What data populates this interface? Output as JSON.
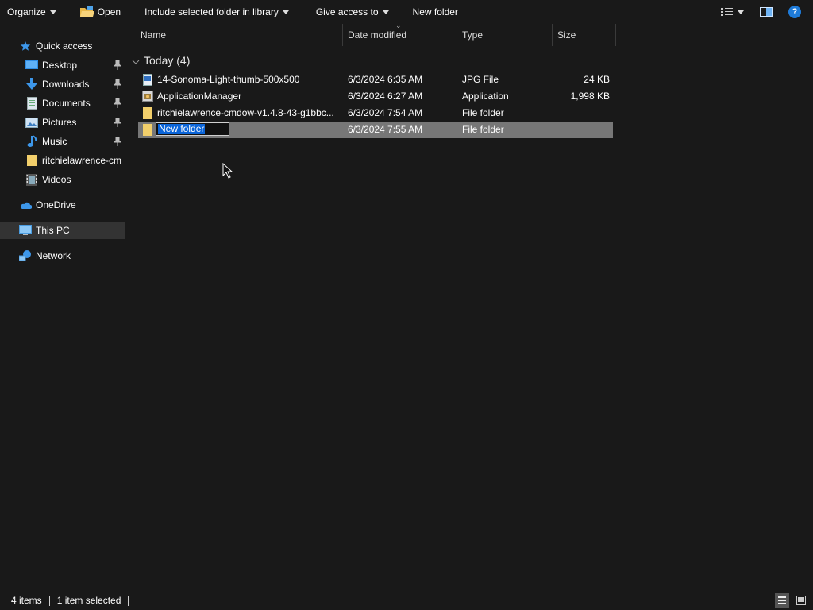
{
  "toolbar": {
    "organize": "Organize",
    "open": "Open",
    "include": "Include selected folder in library",
    "give_access": "Give access to",
    "new_folder": "New folder",
    "help": "?"
  },
  "nav": {
    "quick_access": "Quick access",
    "desktop": "Desktop",
    "downloads": "Downloads",
    "documents": "Documents",
    "pictures": "Pictures",
    "music": "Music",
    "ritchie": "ritchielawrence-cm",
    "videos": "Videos",
    "onedrive": "OneDrive",
    "this_pc": "This PC",
    "network": "Network"
  },
  "columns": {
    "name": "Name",
    "date": "Date modified",
    "type": "Type",
    "size": "Size"
  },
  "group": {
    "label": "Today (4)"
  },
  "files": [
    {
      "name": "14-Sonoma-Light-thumb-500x500",
      "date": "6/3/2024 6:35 AM",
      "type": "JPG File",
      "size": "24 KB"
    },
    {
      "name": "ApplicationManager",
      "date": "6/3/2024 6:27 AM",
      "type": "Application",
      "size": "1,998 KB"
    },
    {
      "name": "ritchielawrence-cmdow-v1.4.8-43-g1bbc...",
      "date": "6/3/2024 7:54 AM",
      "type": "File folder",
      "size": ""
    },
    {
      "name": "New folder",
      "date": "6/3/2024 7:55 AM",
      "type": "File folder",
      "size": ""
    }
  ],
  "status": {
    "items": "4 items",
    "selected": "1 item selected"
  },
  "colors": {
    "background": "#191919",
    "selection": "#777777",
    "rename_highlight": "#0a64d8",
    "folder": "#f2cf6b"
  }
}
